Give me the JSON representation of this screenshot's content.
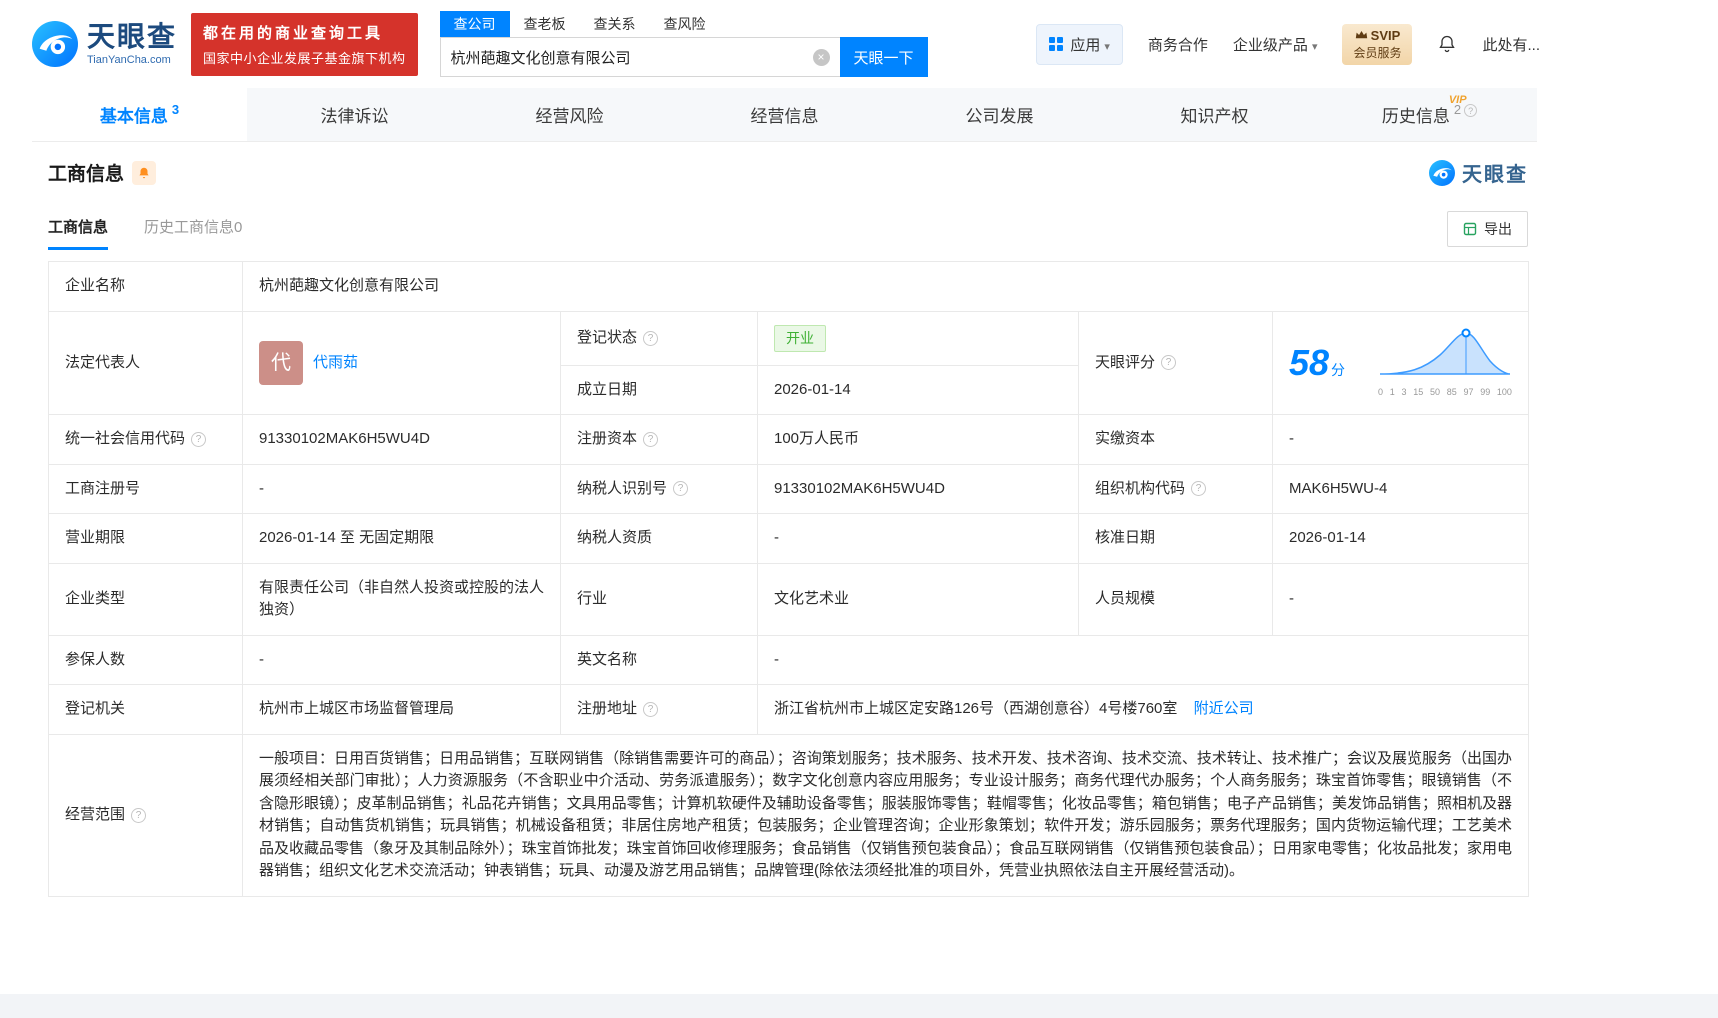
{
  "colors": {
    "accent": "#0084ff",
    "banner_red": "#d5332b",
    "status_green": "#3eb034",
    "status_green_bg": "#eaf8e6",
    "vip_gold_bg": "#f2d5a8",
    "vip_gold_text": "#5f3c13"
  },
  "brand": {
    "name": "天眼查",
    "domain": "TianYanCha.com",
    "banner_line1": "都在用的商业查询工具",
    "banner_line2": "国家中小企业发展子基金旗下机构"
  },
  "search": {
    "tabs": [
      "查公司",
      "查老板",
      "查关系",
      "查风险"
    ],
    "value": "杭州葩趣文化创意有限公司",
    "button_label": "天眼一下"
  },
  "top_nav": {
    "apps_label": "应用",
    "cooperation_label": "商务合作",
    "enterprise_label": "企业级产品",
    "vip_title": "SVIP",
    "vip_subtitle": "会员服务",
    "more_label": "此处有..."
  },
  "page_tabs": {
    "basic": {
      "label": "基本信息",
      "count": "3"
    },
    "legal": {
      "label": "法律诉讼"
    },
    "risk": {
      "label": "经营风险"
    },
    "operation": {
      "label": "经营信息"
    },
    "development": {
      "label": "公司发展"
    },
    "ip": {
      "label": "知识产权"
    },
    "history": {
      "label": "历史信息",
      "count": "2",
      "badge": "VIP"
    }
  },
  "section": {
    "title": "工商信息",
    "watermark": "天眼查",
    "subtab_active": "工商信息",
    "subtab_history": "历史工商信息0",
    "export_label": "导出"
  },
  "company": {
    "name_label": "企业名称",
    "name": "杭州葩趣文化创意有限公司",
    "legal_rep_label": "法定代表人",
    "legal_rep_avatar": "代",
    "legal_rep_name": "代雨茹",
    "reg_status_label": "登记状态",
    "reg_status": "开业",
    "establish_date_label": "成立日期",
    "establish_date": "2026-01-14",
    "score_label": "天眼评分",
    "score_value": "58",
    "score_unit": "分",
    "credit_code_label": "统一社会信用代码",
    "credit_code": "91330102MAK6H5WU4D",
    "reg_capital_label": "注册资本",
    "reg_capital": "100万人民币",
    "paid_capital_label": "实缴资本",
    "paid_capital": "-",
    "reg_no_label": "工商注册号",
    "reg_no": "-",
    "taxpayer_no_label": "纳税人识别号",
    "taxpayer_no": "91330102MAK6H5WU4D",
    "org_code_label": "组织机构代码",
    "org_code": "MAK6H5WU-4",
    "term_label": "营业期限",
    "term": "2026-01-14 至 无固定期限",
    "taxpayer_quality_label": "纳税人资质",
    "taxpayer_quality": "-",
    "approve_date_label": "核准日期",
    "approve_date": "2026-01-14",
    "type_label": "企业类型",
    "type": "有限责任公司（非自然人投资或控股的法人独资）",
    "industry_label": "行业",
    "industry": "文化艺术业",
    "staff_label": "人员规模",
    "staff": "-",
    "insured_label": "参保人数",
    "insured": "-",
    "english_name_label": "英文名称",
    "english_name": "-",
    "authority_label": "登记机关",
    "authority": "杭州市上城区市场监督管理局",
    "address_label": "注册地址",
    "address": "浙江省杭州市上城区定安路126号（西湖创意谷）4号楼760室",
    "nearby_link": "附近公司",
    "scope_label": "经营范围",
    "scope": "一般项目：日用百货销售；日用品销售；互联网销售（除销售需要许可的商品）；咨询策划服务；技术服务、技术开发、技术咨询、技术交流、技术转让、技术推广；会议及展览服务（出国办展须经相关部门审批）；人力资源服务（不含职业中介活动、劳务派遣服务）；数字文化创意内容应用服务；专业设计服务；商务代理代办服务；个人商务服务；珠宝首饰零售；眼镜销售（不含隐形眼镜）；皮革制品销售；礼品花卉销售；文具用品零售；计算机软硬件及辅助设备零售；服装服饰零售；鞋帽零售；化妆品零售；箱包销售；电子产品销售；美发饰品销售；照相机及器材销售；自动售货机销售；玩具销售；机械设备租赁；非居住房地产租赁；包装服务；企业管理咨询；企业形象策划；软件开发；游乐园服务；票务代理服务；国内货物运输代理；工艺美术品及收藏品零售（象牙及其制品除外）；珠宝首饰批发；珠宝首饰回收修理服务；食品销售（仅销售预包装食品）；食品互联网销售（仅销售预包装食品）；日用家电零售；化妆品批发；家用电器销售；组织文化艺术交流活动；钟表销售；玩具、动漫及游艺用品销售；品牌管理(除依法须经批准的项目外，凭营业执照依法自主开展经营活动)。"
  },
  "score_chart": {
    "ticks": [
      "0",
      "1",
      "3",
      "15",
      "50",
      "85",
      "97",
      "99",
      "100"
    ]
  }
}
